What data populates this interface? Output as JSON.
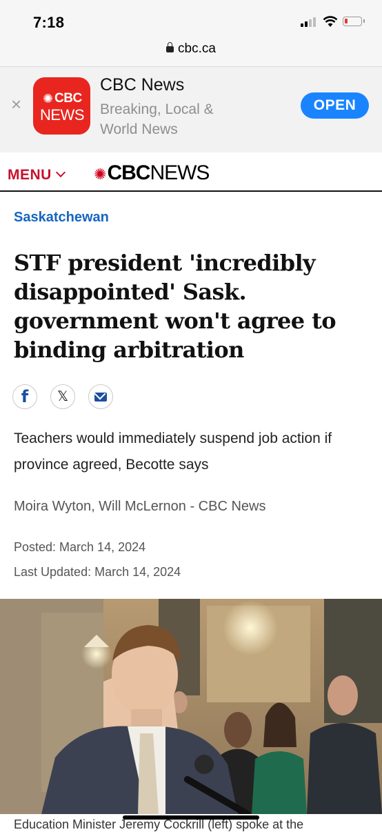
{
  "status_bar": {
    "time": "7:18"
  },
  "browser": {
    "url": "cbc.ca"
  },
  "app_banner": {
    "icon_text_top": "CBC",
    "icon_text_bottom": "NEWS",
    "app_name": "CBC News",
    "description": "Breaking, Local & World News",
    "open_label": "OPEN"
  },
  "site_header": {
    "menu_label": "MENU",
    "logo_cbc": "CBC",
    "logo_news": "NEWS"
  },
  "article": {
    "section": "Saskatchewan",
    "headline": "STF president 'incredibly disappointed' Sask. government won't agree to binding arbitration",
    "deck": "Teachers would immediately suspend job action if province agreed, Becotte says",
    "byline": "Moira Wyton, Will McLernon - CBC News",
    "posted": "Posted: March 14, 2024",
    "last_updated": "Last Updated: March 14, 2024",
    "caption_partial": "Education Minister Jeremy Cockrill (left) spoke at the"
  },
  "share": {
    "facebook": "f",
    "x": "𝕏"
  },
  "colors": {
    "cbc_red": "#c8102e",
    "section_blue": "#1565c0",
    "open_blue": "#1a84ff"
  }
}
